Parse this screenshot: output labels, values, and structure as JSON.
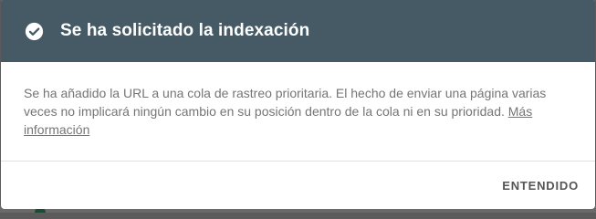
{
  "dialog": {
    "title": "Se ha solicitado la indexación",
    "icon": "check-circle-icon",
    "header_color": "#455a64",
    "body_text": "Se ha añadido la URL a una cola de rastreo prioritaria. El hecho de enviar una página varias veces no implicará ningún cambio en su posición dentro de la cola ni en su prioridad.",
    "more_link": "Más información",
    "ok_label": "ENTENDIDO"
  }
}
